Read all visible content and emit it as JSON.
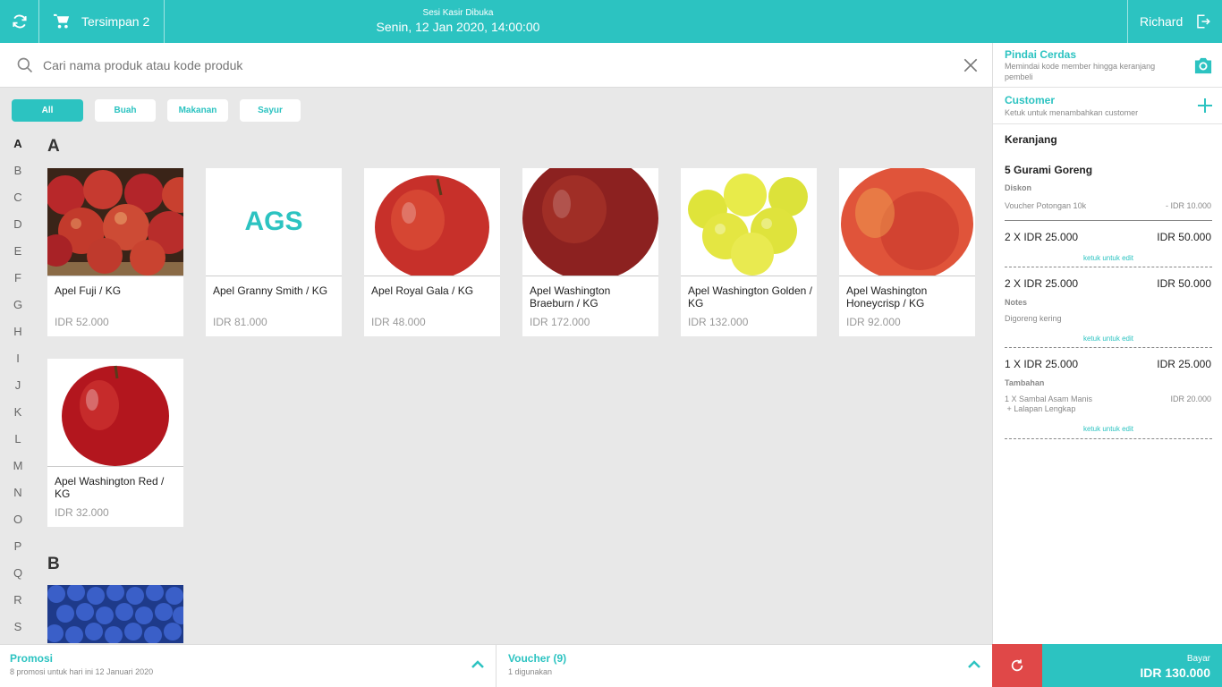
{
  "topbar": {
    "refresh_icon": "refresh-icon",
    "saved_label": "Tersimpan 2",
    "session_label": "Sesi Kasir Dibuka",
    "session_datetime": "Senin, 12 Jan 2020, 14:00:00",
    "user_name": "Richard",
    "logout_icon": "logout-icon",
    "accent": "#2cc3c1"
  },
  "search": {
    "placeholder": "Cari nama produk atau kode produk"
  },
  "categories": [
    "All",
    "Buah",
    "Makanan",
    "Sayur"
  ],
  "alphabet": [
    "A",
    "B",
    "C",
    "D",
    "E",
    "F",
    "G",
    "H",
    "I",
    "J",
    "K",
    "L",
    "M",
    "N",
    "O",
    "P",
    "Q",
    "R",
    "S"
  ],
  "sections": [
    {
      "letter": "A",
      "products": [
        {
          "name": "Apel Fuji / KG",
          "price": "IDR 52.000",
          "image": "apple-basket-image"
        },
        {
          "name": "Apel Granny Smith / KG",
          "price": "IDR 81.000",
          "initials": "AGS"
        },
        {
          "name": "Apel Royal Gala / KG",
          "price": "IDR 48.000",
          "image": "apple-image"
        },
        {
          "name": "Apel Washington Braeburn / KG",
          "price": "IDR 172.000",
          "image": "apple-image"
        },
        {
          "name": "Apel Washington Golden / KG",
          "price": "IDR 132.000",
          "image": "golden-apples-image"
        },
        {
          "name": "Apel Washington Honeycrisp  / KG",
          "price": "IDR 92.000",
          "image": "apple-image"
        },
        {
          "name": "Apel Washington Red / KG",
          "price": "IDR 32.000",
          "image": "apple-image"
        }
      ]
    },
    {
      "letter": "B",
      "products": [
        {
          "image": "blueberries-image"
        }
      ]
    }
  ],
  "smart_scan": {
    "title": "Pindai Cerdas",
    "subtitle": "Memindai kode member hingga keranjang pembeli",
    "icon": "camera-icon"
  },
  "customer": {
    "title": "Customer",
    "subtitle": "Ketuk untuk menambahkan customer",
    "icon": "plus-icon"
  },
  "cart": {
    "title": "Keranjang",
    "item_title": "5 Gurami Goreng",
    "discount_label": "Diskon",
    "voucher_name": "Voucher Potongan 10k",
    "voucher_value": "- IDR 10.000",
    "lines": [
      {
        "qty": "2 X IDR 25.000",
        "total": "IDR 50.000",
        "edit": "ketuk untuk edit"
      },
      {
        "qty": "2 X IDR 25.000",
        "total": "IDR 50.000",
        "notes_label": "Notes",
        "notes": "Digoreng kering",
        "edit": "ketuk untuk edit"
      },
      {
        "qty": "1 X IDR 25.000",
        "total": "IDR 25.000",
        "extra_label": "Tambahan",
        "extra_line1": "1 X Sambal Asam Manis",
        "extra_line2": " + Lalapan Lengkap",
        "extra_price": "IDR 20.000",
        "edit": "ketuk untuk edit"
      }
    ]
  },
  "bottom": {
    "promo_title": "Promosi",
    "promo_sub": "8 promosi untuk hari ini 12 Januari 2020",
    "voucher_title": "Voucher (9)",
    "voucher_sub": "1 digunakan",
    "pay_label": "Bayar",
    "pay_total": "IDR 130.000",
    "reset_color": "#e04848"
  }
}
